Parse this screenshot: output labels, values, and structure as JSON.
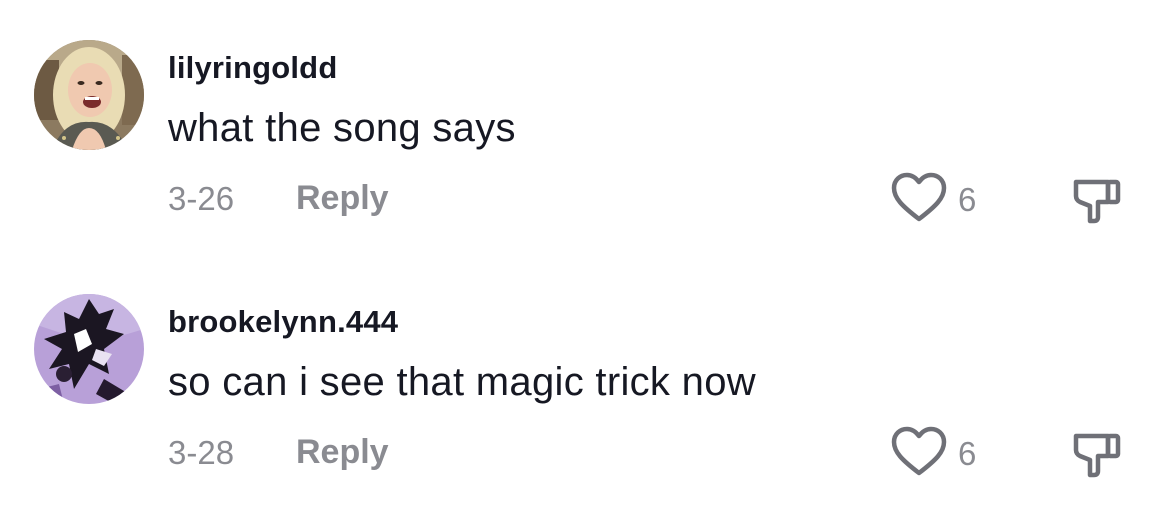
{
  "comments": [
    {
      "username": "lilyringoldd",
      "text": "what the song says",
      "date": "3-26",
      "reply_label": "Reply",
      "likes": "6",
      "avatar": "blonde-person-photo"
    },
    {
      "username": "brookelynn.444",
      "text": "so can i see that magic trick now",
      "date": "3-28",
      "reply_label": "Reply",
      "likes": "6",
      "avatar": "purple-comic-art"
    }
  ],
  "icons": {
    "like": "heart-outline-icon",
    "dislike": "thumbs-down-outline-icon"
  },
  "colors": {
    "text": "#161823",
    "secondary": "#8a8b91",
    "avatar2_bg": "#b8a0d8"
  }
}
